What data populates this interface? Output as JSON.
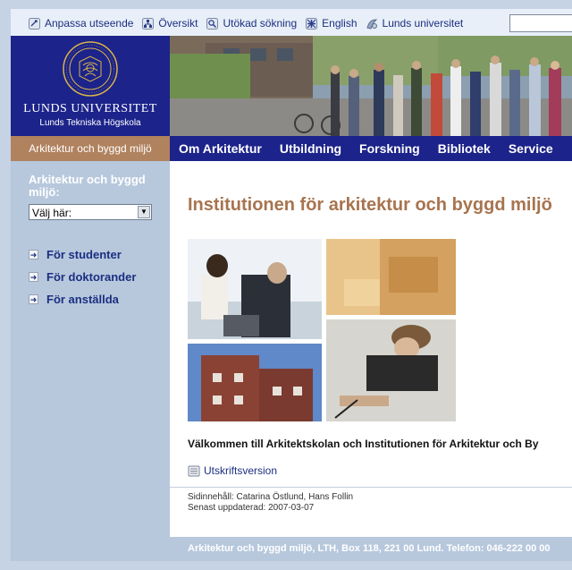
{
  "toplinks": [
    {
      "label": "Anpassa utseende",
      "icon": "customize-icon"
    },
    {
      "label": "Översikt",
      "icon": "sitemap-icon"
    },
    {
      "label": "Utökad sökning",
      "icon": "magnifier-icon"
    },
    {
      "label": "English",
      "icon": "flag-icon"
    },
    {
      "label": "Lunds universitet",
      "icon": "university-icon"
    }
  ],
  "logo": {
    "name": "LUNDS UNIVERSITET",
    "sub": "Lunds Tekniska Högskola"
  },
  "section_tab": "Arkitektur och byggd miljö",
  "nav": [
    "Om Arkitektur",
    "Utbildning",
    "Forskning",
    "Bibliotek",
    "Service"
  ],
  "sidebar": {
    "title": "Arkitektur och byggd miljö:",
    "select_value": "Välj här:",
    "links": [
      "För studenter",
      "För doktorander",
      "För anställda"
    ]
  },
  "main": {
    "title": "Institutionen för arkitektur och byggd miljö",
    "welcome": "Välkommen till Arkitektskolan och Institutionen för Arkitektur och By",
    "print_label": "Utskriftsversion",
    "meta_content": "Sidinnehåll: Catarina Östlund, Hans Follin",
    "meta_updated": "Senast uppdaterad: 2007-03-07"
  },
  "footer": "Arkitektur och byggd miljö, LTH, Box 118, 221 00 Lund. Telefon: 046-222 00 00",
  "colors": {
    "brand_blue": "#1c238a",
    "accent_brown": "#b0825e",
    "title_brown": "#a7744f",
    "sidebar": "#b7c8dd"
  }
}
